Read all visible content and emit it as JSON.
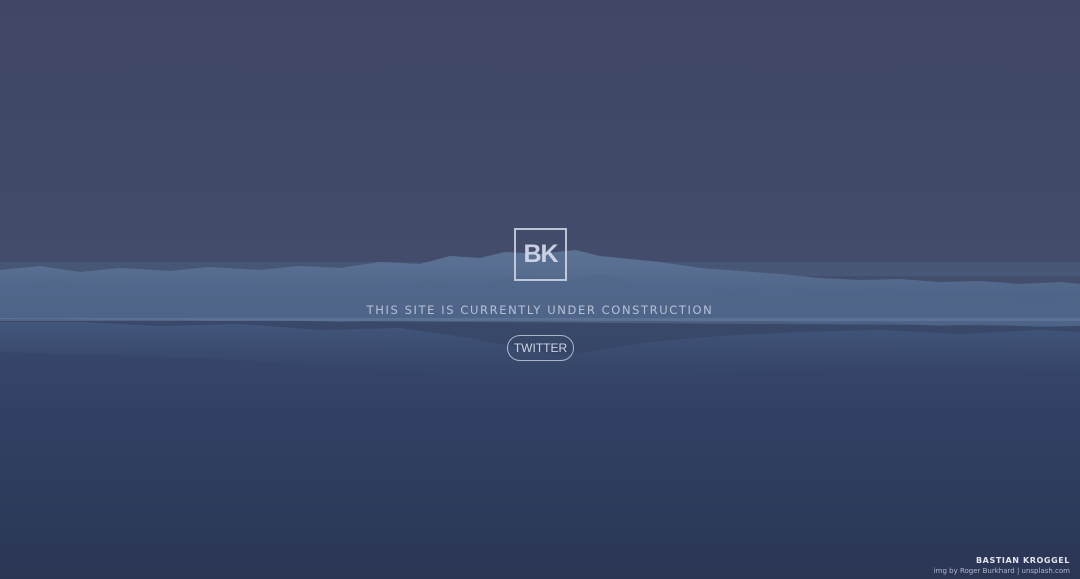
{
  "logo": {
    "text": "BK"
  },
  "tagline": "THIS SITE IS CURRENTLY UNDER CONSTRUCTION",
  "buttons": {
    "twitter_label": "TWITTER"
  },
  "footer": {
    "author": "BASTIAN KROGGEL",
    "credit": "img by Roger Burkhard | unsplash.com"
  },
  "colors": {
    "sky": "#434c6b",
    "water": "#32415f",
    "ice": "#5f7ba0"
  }
}
